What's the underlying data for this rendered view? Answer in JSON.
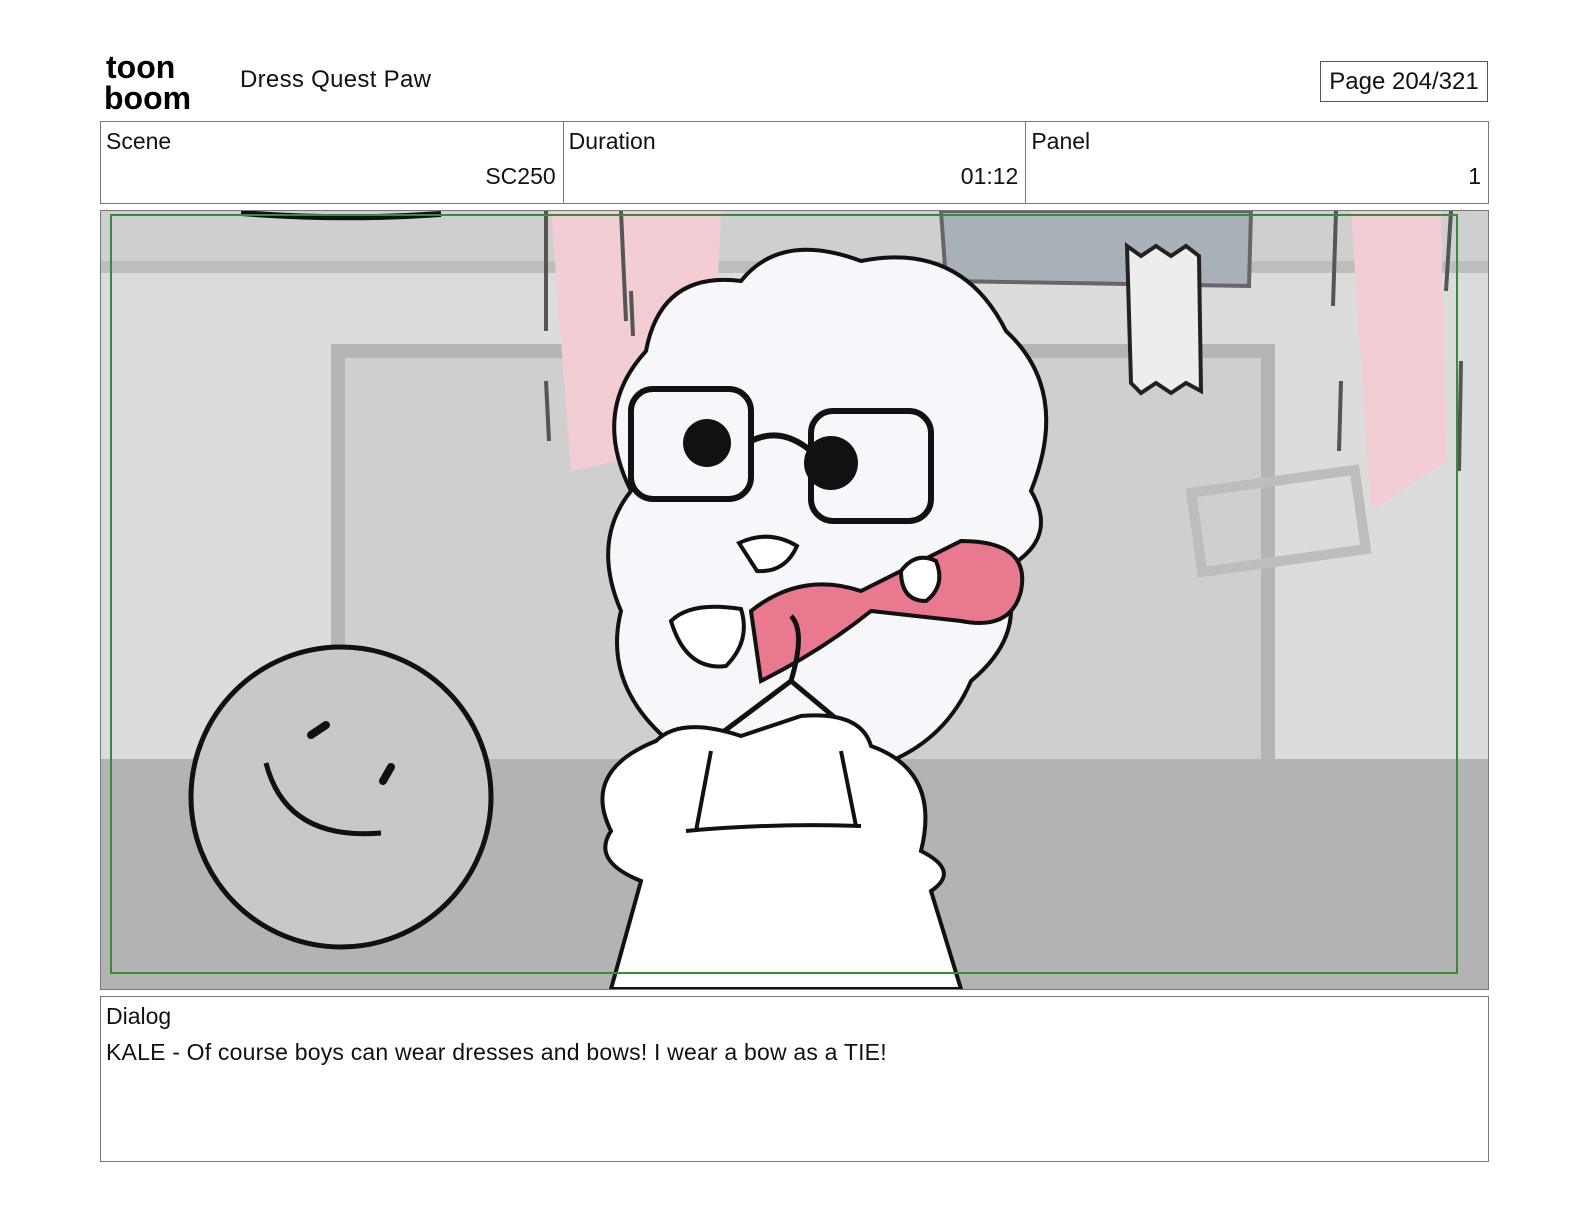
{
  "header": {
    "logo_text_top": "toon",
    "logo_text_bottom": "boom",
    "project_title": "Dress Quest Paw",
    "page_label": "Page 204/321"
  },
  "info": {
    "scene_label": "Scene",
    "scene_value": "SC250",
    "duration_label": "Duration",
    "duration_value": "01:12",
    "panel_label": "Panel",
    "panel_value": "1"
  },
  "panel_image": {
    "icon": "storyboard-drawing",
    "colors": {
      "wall": "#dcdcdc",
      "floor": "#b3b3b3",
      "accent_pink": "#e8798f",
      "curtain_pink": "#f2cdd4",
      "safe_frame": "#3a8a3a"
    }
  },
  "dialog": {
    "label": "Dialog",
    "text": "KALE - Of course boys can wear dresses and bows! I wear a bow as a TIE!"
  }
}
